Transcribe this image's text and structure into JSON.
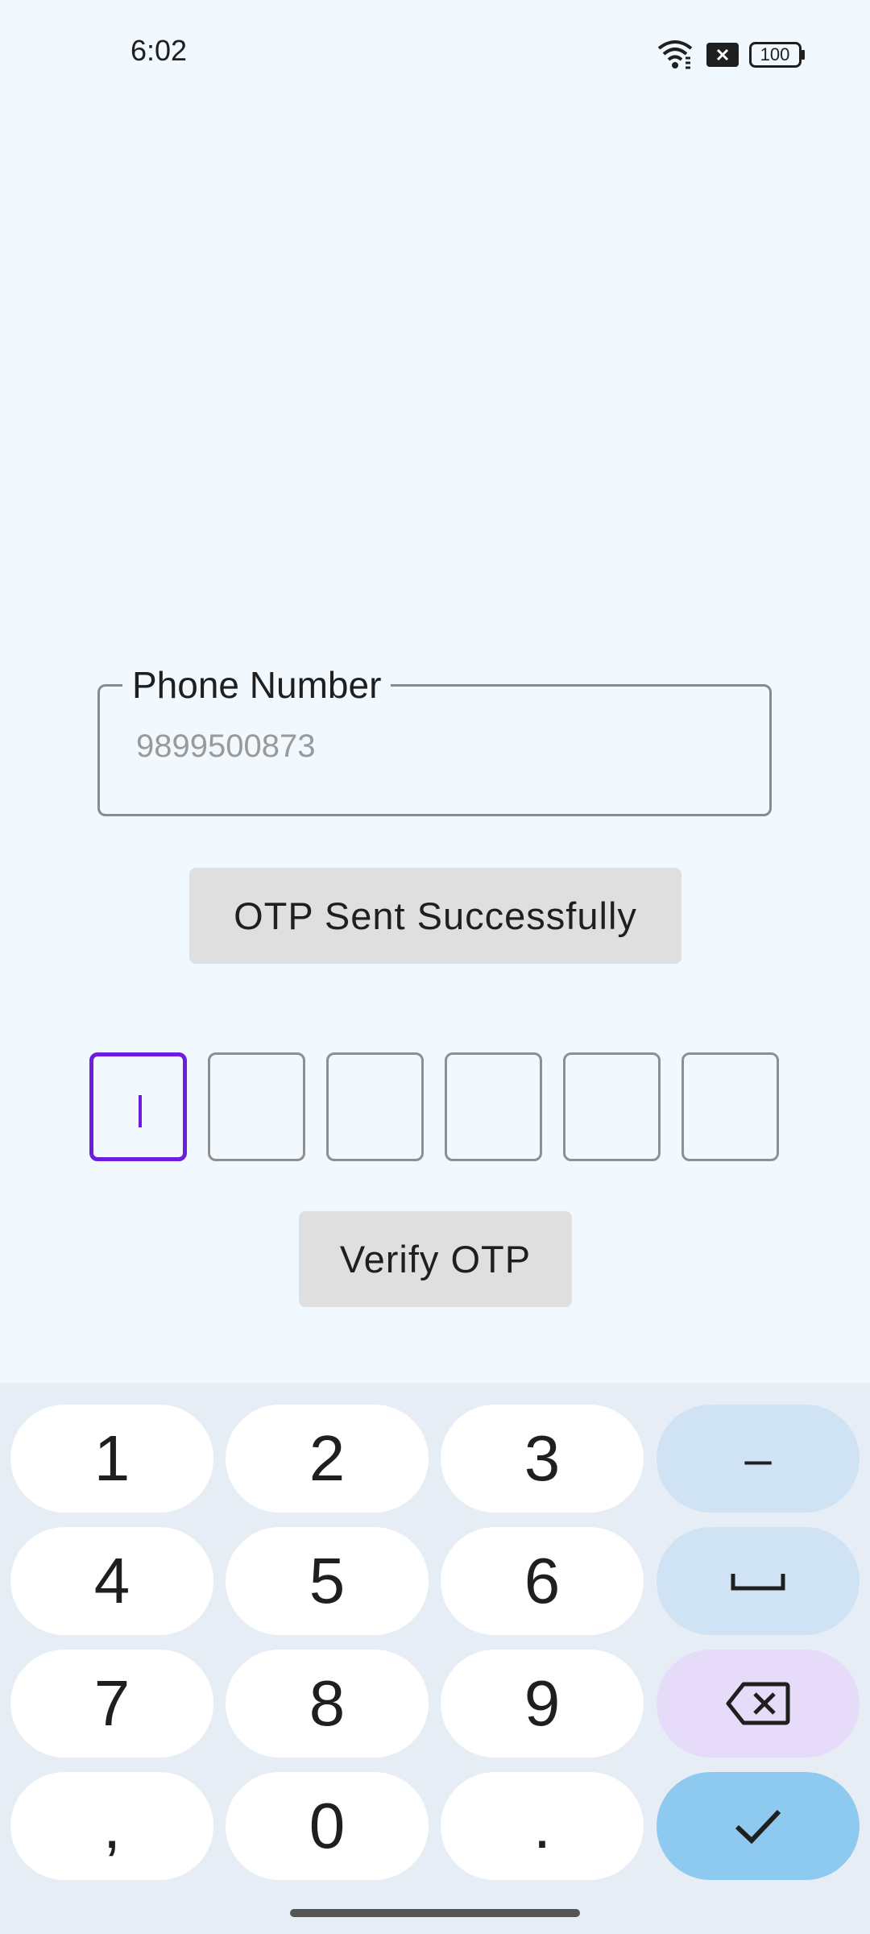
{
  "status_bar": {
    "time": "6:02",
    "battery": "100"
  },
  "phone_field": {
    "label": "Phone Number",
    "value": "9899500873"
  },
  "otp_status_button": "OTP Sent Successfully",
  "otp_inputs": [
    "",
    "",
    "",
    "",
    "",
    ""
  ],
  "verify_button": "Verify OTP",
  "keyboard": {
    "rows": [
      [
        "1",
        "2",
        "3",
        "–"
      ],
      [
        "4",
        "5",
        "6",
        "space"
      ],
      [
        "7",
        "8",
        "9",
        "backspace"
      ],
      [
        ",",
        "0",
        ".",
        "enter"
      ]
    ],
    "labels": {
      "k1": "1",
      "k2": "2",
      "k3": "3",
      "k4": "4",
      "k5": "5",
      "k6": "6",
      "k7": "7",
      "k8": "8",
      "k9": "9",
      "k0": "0",
      "comma": ",",
      "period": ".",
      "dash": "–"
    }
  },
  "colors": {
    "accent": "#6e1de0",
    "background": "#f1f8fe",
    "enter_key": "#8ec9f0"
  }
}
